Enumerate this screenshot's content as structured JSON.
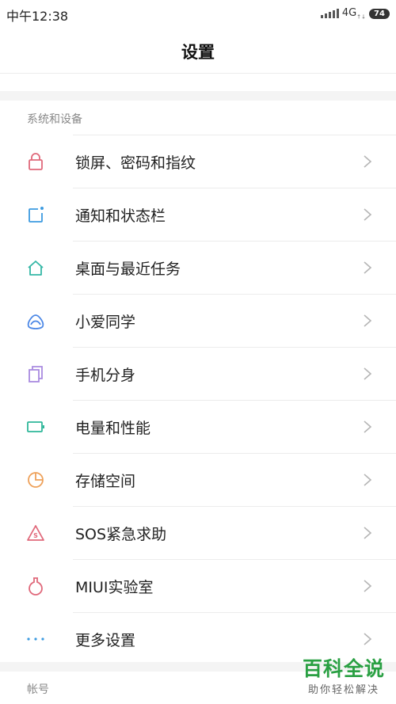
{
  "status_bar": {
    "time": "中午12:38",
    "network": "4G",
    "battery": "74"
  },
  "header": {
    "title": "设置"
  },
  "sections": [
    {
      "label": "系统和设备"
    },
    {
      "label": "帐号"
    }
  ],
  "items": [
    {
      "label": "锁屏、密码和指纹",
      "icon": "lock-icon",
      "color": "#e0697b"
    },
    {
      "label": "通知和状态栏",
      "icon": "notification-icon",
      "color": "#3d9be0"
    },
    {
      "label": "桌面与最近任务",
      "icon": "home-icon",
      "color": "#34b7a6"
    },
    {
      "label": "小爱同学",
      "icon": "xiaoai-icon",
      "color": "#4b87e6"
    },
    {
      "label": "手机分身",
      "icon": "second-space-icon",
      "color": "#a98be0"
    },
    {
      "label": "电量和性能",
      "icon": "battery-icon",
      "color": "#2fb79a"
    },
    {
      "label": "存储空间",
      "icon": "storage-pie-icon",
      "color": "#eea15a"
    },
    {
      "label": "SOS紧急求助",
      "icon": "sos-icon",
      "color": "#e0697b"
    },
    {
      "label": "MIUI实验室",
      "icon": "lab-flask-icon",
      "color": "#e0697b"
    },
    {
      "label": "更多设置",
      "icon": "more-dots-icon",
      "color": "#3d9be0"
    }
  ],
  "watermark": {
    "title": "百科全说",
    "subtitle": "助你轻松解决"
  }
}
